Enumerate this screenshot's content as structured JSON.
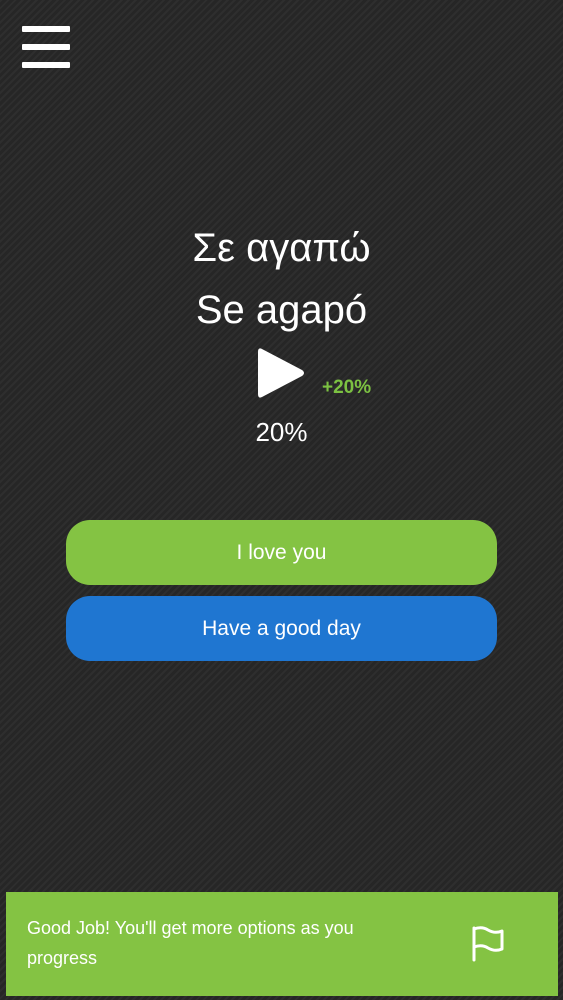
{
  "menu": {
    "icon": "hamburger-menu-icon"
  },
  "phrase": {
    "native": "Σε αγαπώ",
    "transliteration": "Se agapó"
  },
  "audio": {
    "icon": "play-icon"
  },
  "score": {
    "bonus": "+20%",
    "progress": "20%",
    "progress_value": 0.2
  },
  "answers": [
    {
      "label": "I love you",
      "color": "#84c343"
    },
    {
      "label": "Have a good day",
      "color": "#1f76d1"
    }
  ],
  "toast": {
    "message": "Good Job! You'll get more options as you progress",
    "icon": "flag-icon",
    "color": "#84c343"
  },
  "colors": {
    "background": "#2b2b2b",
    "accent_green": "#7cc242"
  }
}
